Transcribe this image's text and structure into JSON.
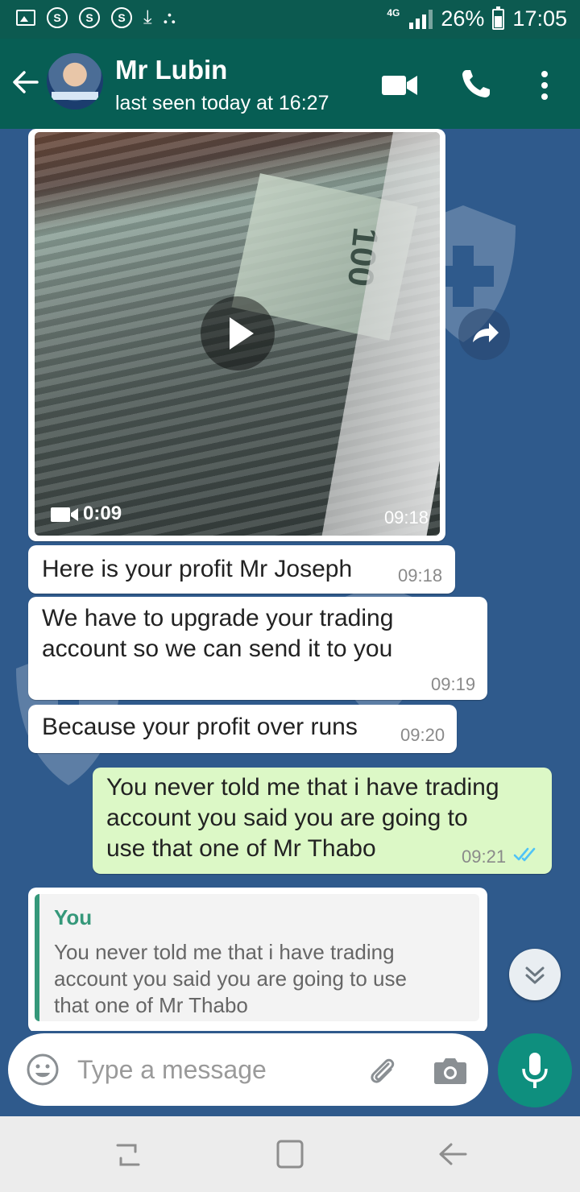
{
  "status_bar": {
    "notification_icons": [
      "image-icon",
      "s-icon",
      "s-icon",
      "s-icon",
      "download-icon",
      "people-icon"
    ],
    "s_label": "S",
    "network": "4G",
    "battery": "26%",
    "time": "17:05"
  },
  "app_bar": {
    "contact_name": "Mr Lubin",
    "last_seen": "last seen today at 16:27",
    "actions": [
      "video-call-icon",
      "phone-icon",
      "more-options-icon"
    ]
  },
  "messages": [
    {
      "type": "video",
      "direction": "incoming",
      "duration": "0:09",
      "time": "09:18",
      "thumbnail_text": "100"
    },
    {
      "type": "text",
      "direction": "incoming",
      "lines": [
        "Here is your profit Mr Joseph"
      ],
      "time": "09:18"
    },
    {
      "type": "text",
      "direction": "incoming",
      "lines": [
        "We have to upgrade your trading",
        "account so we can send it to you"
      ],
      "time": "09:19"
    },
    {
      "type": "text",
      "direction": "incoming",
      "lines": [
        "Because your profit over runs"
      ],
      "time": "09:20"
    },
    {
      "type": "text",
      "direction": "outgoing",
      "lines": [
        "You never told me that i have trading",
        "account you said you are going to",
        "use that one of Mr Thabo"
      ],
      "time": "09:21",
      "status": "read"
    },
    {
      "type": "reply",
      "direction": "incoming",
      "quoted_author": "You",
      "quoted_lines": [
        "You never told me that i have trading",
        "account you said you are going to use",
        "that one of Mr Thabo"
      ]
    }
  ],
  "composer": {
    "placeholder": "Type a message"
  },
  "colors": {
    "header": "#075e54",
    "status_bar": "#0c5a50",
    "chat_background": "#2f5a8c",
    "outgoing_bubble": "#dcf8c6",
    "incoming_bubble": "#ffffff",
    "accent": "#0e8f7e",
    "read_ticks": "#4fc3f7"
  }
}
